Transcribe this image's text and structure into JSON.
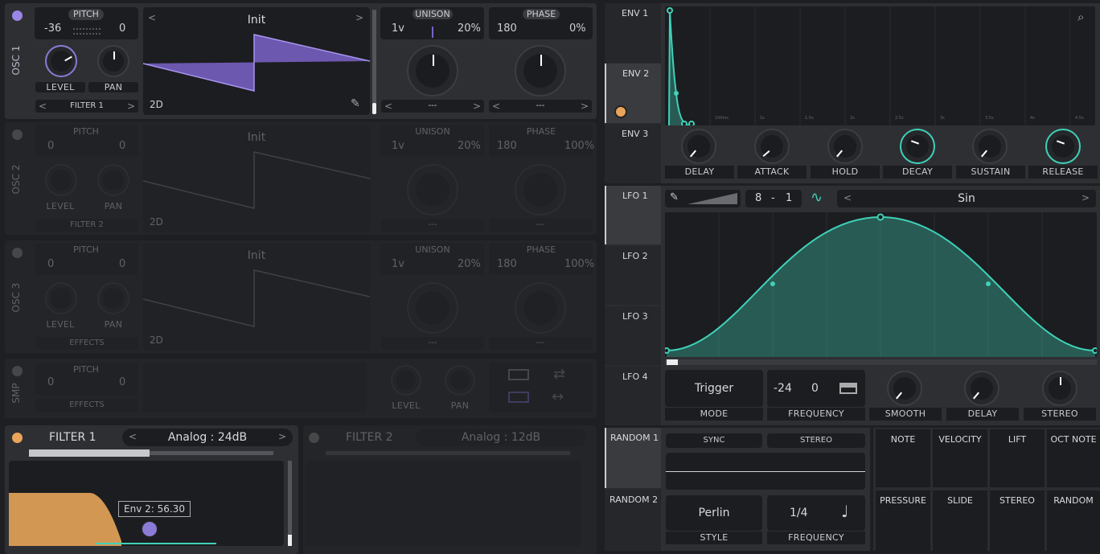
{
  "osc1": {
    "name": "OSC 1",
    "pitch_label": "PITCH",
    "pitch_left": "-36",
    "pitch_right": "0",
    "level": "LEVEL",
    "pan": "PAN",
    "dest": "FILTER 1",
    "wave_name": "Init",
    "wave_mode": "2D",
    "unison_label": "UNISON",
    "unison_voices": "1v",
    "unison_pct": "20%",
    "phase_label": "PHASE",
    "phase_val": "180",
    "phase_pct": "0%",
    "dd1": "---",
    "dd2": "---"
  },
  "osc2": {
    "name": "OSC 2",
    "pitch_label": "PITCH",
    "pitch_left": "0",
    "pitch_right": "0",
    "level": "LEVEL",
    "pan": "PAN",
    "dest": "FILTER 2",
    "wave_name": "Init",
    "wave_mode": "2D",
    "unison_label": "UNISON",
    "unison_voices": "1v",
    "unison_pct": "20%",
    "phase_label": "PHASE",
    "phase_val": "180",
    "phase_pct": "100%",
    "dd1": "---",
    "dd2": "---"
  },
  "osc3": {
    "name": "OSC 3",
    "pitch_label": "PITCH",
    "pitch_left": "0",
    "pitch_right": "0",
    "level": "LEVEL",
    "pan": "PAN",
    "dest": "EFFECTS",
    "wave_name": "Init",
    "wave_mode": "2D",
    "unison_label": "UNISON",
    "unison_voices": "1v",
    "unison_pct": "20%",
    "phase_label": "PHASE",
    "phase_val": "180",
    "phase_pct": "100%",
    "dd1": "---",
    "dd2": "---"
  },
  "smp": {
    "name": "SMP",
    "pitch_label": "PITCH",
    "pitch_left": "0",
    "pitch_right": "0",
    "dest": "EFFECTS",
    "level": "LEVEL",
    "pan": "PAN"
  },
  "filter1": {
    "name": "FILTER 1",
    "type": "Analog",
    "slope": "24dB",
    "tooltip": "Env 2: 56.30"
  },
  "filter2": {
    "name": "FILTER 2",
    "type": "Analog",
    "slope": "12dB"
  },
  "env_tabs": [
    "ENV 1",
    "ENV 2",
    "ENV 3"
  ],
  "env_knobs": [
    "DELAY",
    "ATTACK",
    "HOLD",
    "DECAY",
    "SUSTAIN",
    "RELEASE"
  ],
  "env_time_labels": [
    "100ms",
    "1s",
    "1.5s",
    "2s",
    "2.5s",
    "3s",
    "3.5s",
    "4s",
    "4.5s"
  ],
  "lfo_tabs": [
    "LFO 1",
    "LFO 2",
    "LFO 3",
    "LFO 4"
  ],
  "lfo": {
    "rate_num": "8",
    "rate_sep": "-",
    "rate_den": "1",
    "shape": "Sin",
    "mode": "Trigger",
    "mode_label": "MODE",
    "freq_a": "-24",
    "freq_b": "0",
    "freq_label": "FREQUENCY",
    "smooth": "SMOOTH",
    "delay": "DELAY",
    "stereo": "STEREO"
  },
  "random_tabs": [
    "RANDOM 1",
    "RANDOM 2"
  ],
  "random": {
    "sync": "SYNC",
    "stereo": "STEREO",
    "style": "Perlin",
    "style_label": "STYLE",
    "freq": "1/4",
    "freq_label": "FREQUENCY"
  },
  "mod_sources": [
    "NOTE",
    "VELOCITY",
    "LIFT",
    "OCT NOTE",
    "PRESSURE",
    "SLIDE",
    "STEREO",
    "RANDOM"
  ],
  "colors": {
    "accent_purple": "#9a86e6",
    "accent_teal": "#3fd1b8",
    "accent_orange": "#e8a55a"
  }
}
